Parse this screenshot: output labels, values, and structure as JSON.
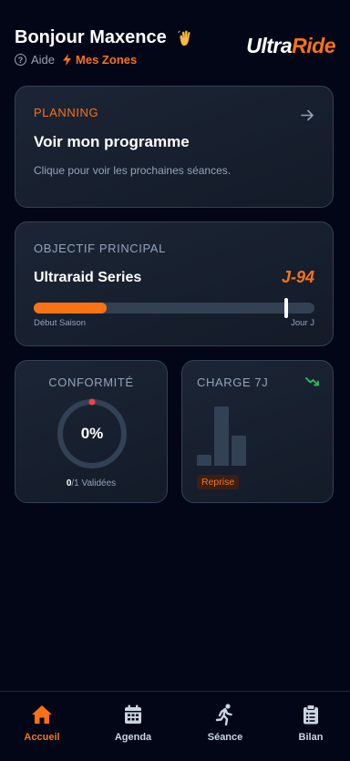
{
  "header": {
    "greeting": "Bonjour Maxence",
    "aide_label": "Aide",
    "zones_label": "Mes Zones",
    "logo_ultra": "Ultra",
    "logo_ride": "Ride"
  },
  "planning": {
    "label": "PLANNING",
    "title": "Voir mon programme",
    "description": "Clique pour voir les prochaines séances."
  },
  "objectif": {
    "label": "OBJECTIF PRINCIPAL",
    "name": "Ultraraid Series",
    "countdown": "J-94",
    "progress_fraction": 0.26,
    "marker_fraction": 0.9,
    "start_label": "Début Saison",
    "end_label": "Jour J"
  },
  "conformite": {
    "label": "CONFORMITÉ",
    "value": "0%",
    "validated_count": "0",
    "validated_rest": "/1 Validées"
  },
  "charge": {
    "label": "CHARGE 7J",
    "trend_icon": "trend-down-icon",
    "trend_color": "#22c55e",
    "bar_levels": [
      0.18,
      1.0,
      0.5
    ],
    "badge": "Reprise"
  },
  "nav": {
    "items": [
      {
        "label": "Accueil",
        "icon": "home-icon",
        "active": true
      },
      {
        "label": "Agenda",
        "icon": "calendar-icon",
        "active": false
      },
      {
        "label": "Séance",
        "icon": "runner-icon",
        "active": false
      },
      {
        "label": "Bilan",
        "icon": "clipboard-icon",
        "active": false
      }
    ]
  },
  "colors": {
    "accent": "#f97316",
    "background": "#020617",
    "card_border": "#334155"
  }
}
